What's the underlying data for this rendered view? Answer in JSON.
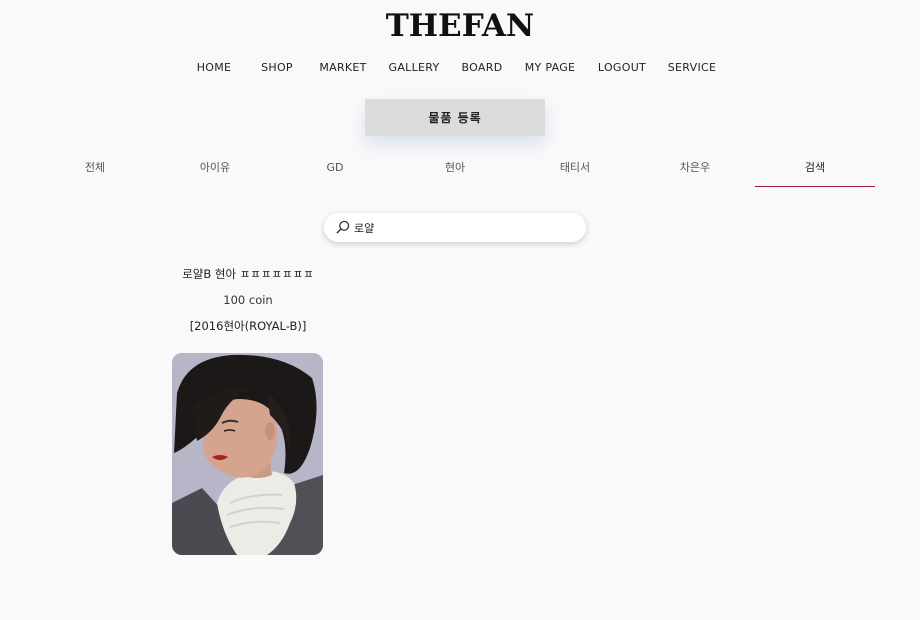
{
  "brand": {
    "logo": "THEFAN"
  },
  "nav": {
    "items": [
      "HOME",
      "SHOP",
      "MARKET",
      "GALLERY",
      "BOARD",
      "MY PAGE",
      "LOGOUT",
      "SERVICE"
    ]
  },
  "actions": {
    "register_label": "물품 등록"
  },
  "categories": {
    "tabs": [
      "전체",
      "아이유",
      "GD",
      "현아",
      "태티서",
      "차은우",
      "검색"
    ],
    "active": "검색",
    "accent_color": "#a11a57"
  },
  "search": {
    "value": "로얄",
    "icon": "search-icon"
  },
  "results": [
    {
      "title": "로얄B 현아 ㅍㅍㅍㅍㅍㅍㅍ",
      "price": "100 coin",
      "code": "[2016현아(ROYAL-B)]",
      "image": "photocard-portrait"
    }
  ]
}
